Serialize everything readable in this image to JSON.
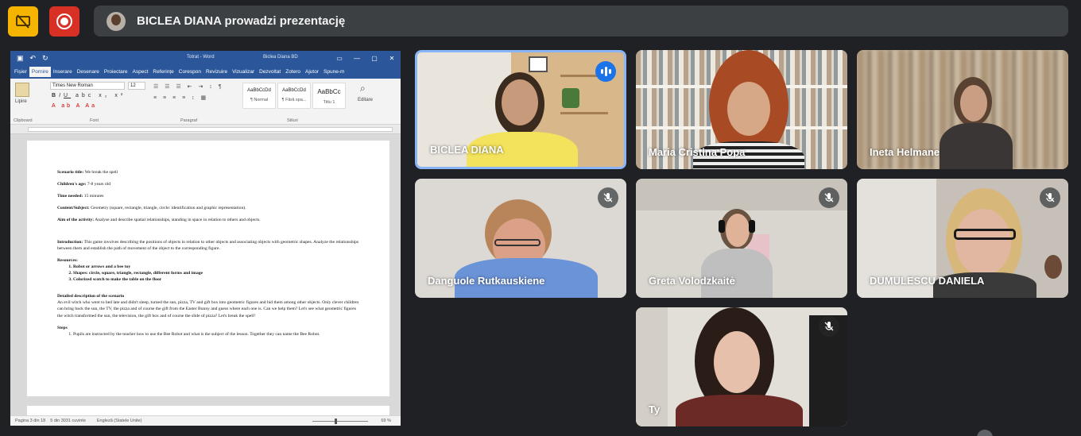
{
  "presentation_bar": {
    "presenter_text": "BICLEA DIANA prowadzi prezentację"
  },
  "word": {
    "title_parts": [
      "Totrat",
      "Word",
      "Biclea Diana",
      "BD"
    ],
    "tabs": [
      "Fișier",
      "Pornire",
      "Inserare",
      "Desenare",
      "Proiectare",
      "Aspect",
      "Referințe",
      "Corespon",
      "Revizuire",
      "Vizualizar",
      "Dezvoltat",
      "Zotero",
      "Ajutor",
      "Spune-m"
    ],
    "font_name": "Times New Roman",
    "font_size": "12",
    "styles": [
      {
        "preview": "AaBbCcDd",
        "name": "¶ Normal"
      },
      {
        "preview": "AaBbCcDd",
        "name": "¶ Fără spa..."
      },
      {
        "preview": "AaBbCc",
        "name": "Titlu 1"
      }
    ],
    "group_labels": [
      "Clipboard",
      "Font",
      "Paragraf",
      "Stiluri"
    ],
    "paste_label": "Lipire",
    "edit_label": "Editare",
    "document": {
      "scenario_label": "Scenario title:",
      "scenario_value": "We break the spell",
      "ages_label": "Children's age:",
      "ages_value": "7-8 years old",
      "time_label": "Time needed:",
      "time_value": "15 minutes",
      "content_label": "Content/Subject:",
      "content_value": "Geometry (square, rectangle, triangle, circle: identification and graphic representation).",
      "aim_label": "Aim of the activity:",
      "aim_value": "Analyse and describe spatial relationships, standing in space in relation to others and objects.",
      "intro_label": "Introduction:",
      "intro_value": "This game involves describing the positions of objects in relation to other objects and associating objects with geometric shapes. Analyze the relationships between them and establish the path of movement of the object to the corresponding figure.",
      "resources_label": "Resources:",
      "resources": [
        "Robot or arrows and a bee toy",
        "Shapes: circle, square, triangle, rectangle, different forms and image",
        "Colorized scotch to make the table on the floor"
      ],
      "detailed_label": "Detailed description of the scenario",
      "detailed_value": "An evil witch who went to bed late and didn't sleep, turned the sun, pizza, TV and gift box into geometric figures and hid them among other objects. Only clever children can bring back the sun, the TV, the pizza and of course the gift from the Easter Bunny and guess where each one is. Can we help them? Let's see what geometric figures the witch transformed the sun, the television, the gift box and of course the slide of pizza? Let's break the spell!",
      "steps_label": "Steps",
      "steps": [
        "Pupils are instructed by the teacher how to use the Bee Robot and what is the subject of the lesson. Together they can name the Bee Robot."
      ]
    },
    "status": {
      "page": "Pagina 3 din 18",
      "words": "5 din 3031 cuvinte",
      "language": "Engleză (Statele Unite)",
      "zoom": "69 %"
    }
  },
  "participants": [
    {
      "name": "BICLEA DIANA",
      "state": "speaking"
    },
    {
      "name": "Maria Cristina Popa",
      "state": "none"
    },
    {
      "name": "Ineta Helmane",
      "state": "none"
    },
    {
      "name": "Danguole Rutkauskiene",
      "state": "muted"
    },
    {
      "name": "Greta Volodzkaitė",
      "state": "muted"
    },
    {
      "name": "DUMULESCU DANIELA",
      "state": "muted"
    },
    {
      "name": "Ty",
      "state": "muted"
    }
  ],
  "colors": {
    "background": "#202124",
    "present_button": "#f4b400",
    "record_button": "#d93025",
    "active_speaker_border": "#8ab4f8",
    "word_blue": "#2b579a"
  }
}
